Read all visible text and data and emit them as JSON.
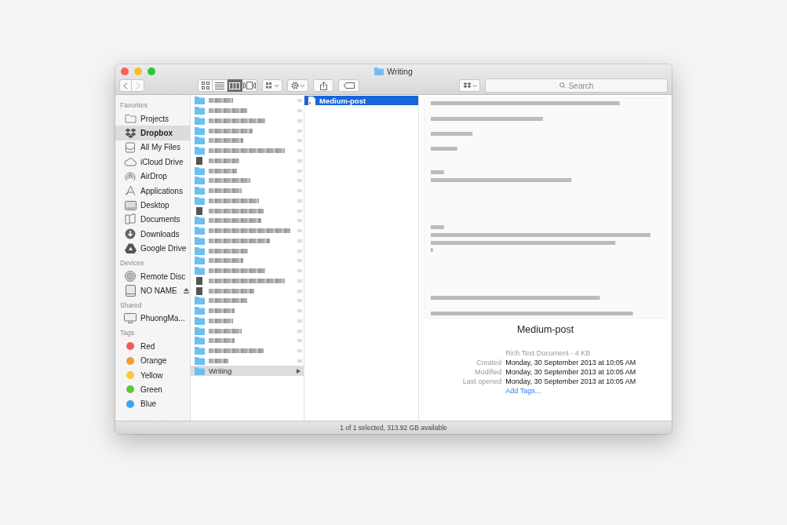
{
  "window": {
    "title": "Writing"
  },
  "toolbar": {
    "view_buttons": [
      {
        "kind": "icon",
        "selected": false
      },
      {
        "kind": "list",
        "selected": false
      },
      {
        "kind": "columns",
        "selected": true
      },
      {
        "kind": "coverflow",
        "selected": false
      }
    ],
    "search": {
      "placeholder": "Search"
    }
  },
  "sidebar": {
    "sections": [
      {
        "title": "Favorites",
        "items": [
          {
            "kind": "folder",
            "label": "Projects",
            "selected": false
          },
          {
            "kind": "dropbox",
            "label": "Dropbox",
            "selected": true
          },
          {
            "kind": "allfiles",
            "label": "All My Files",
            "selected": false
          },
          {
            "kind": "cloud",
            "label": "iCloud Drive",
            "selected": false
          },
          {
            "kind": "airdrop",
            "label": "AirDrop",
            "selected": false
          },
          {
            "kind": "apps",
            "label": "Applications",
            "selected": false
          },
          {
            "kind": "desktop",
            "label": "Desktop",
            "selected": false
          },
          {
            "kind": "documents",
            "label": "Documents",
            "selected": false
          },
          {
            "kind": "downloads",
            "label": "Downloads",
            "selected": false
          },
          {
            "kind": "gdrive",
            "label": "Google Drive",
            "selected": false
          }
        ]
      },
      {
        "title": "Devices",
        "items": [
          {
            "kind": "disc",
            "label": "Remote Disc",
            "selected": false
          },
          {
            "kind": "drive",
            "label": "NO NAME",
            "selected": false,
            "eject": true
          }
        ]
      },
      {
        "title": "Shared",
        "items": [
          {
            "kind": "computer",
            "label": "PhuongMa...",
            "selected": false
          }
        ]
      },
      {
        "title": "Tags",
        "items": [
          {
            "kind": "tag",
            "label": "Red",
            "color": "#f25a53",
            "selected": false
          },
          {
            "kind": "tag",
            "label": "Orange",
            "color": "#f79a35",
            "selected": false
          },
          {
            "kind": "tag",
            "label": "Yellow",
            "color": "#f6c938",
            "selected": false
          },
          {
            "kind": "tag",
            "label": "Green",
            "color": "#5bc63f",
            "selected": false
          },
          {
            "kind": "tag",
            "label": "Blue",
            "color": "#3ba6f4",
            "selected": false
          }
        ]
      }
    ]
  },
  "columns": [
    {
      "items": [
        {
          "kind": "folder"
        },
        {
          "kind": "folder"
        },
        {
          "kind": "folder"
        },
        {
          "kind": "folder"
        },
        {
          "kind": "folder"
        },
        {
          "kind": "folder"
        },
        {
          "kind": "file"
        },
        {
          "kind": "folder"
        },
        {
          "kind": "folder"
        },
        {
          "kind": "folder"
        },
        {
          "kind": "folder"
        },
        {
          "kind": "file"
        },
        {
          "kind": "folder"
        },
        {
          "kind": "folder"
        },
        {
          "kind": "folder"
        },
        {
          "kind": "folder"
        },
        {
          "kind": "folder"
        },
        {
          "kind": "folder"
        },
        {
          "kind": "file"
        },
        {
          "kind": "file"
        },
        {
          "kind": "folder"
        },
        {
          "kind": "folder"
        },
        {
          "kind": "folder"
        },
        {
          "kind": "folder"
        },
        {
          "kind": "folder"
        },
        {
          "kind": "folder"
        },
        {
          "kind": "folder"
        },
        {
          "kind": "folder",
          "name": "Writing",
          "selected": true
        }
      ]
    },
    {
      "items": [
        {
          "kind": "document",
          "name": "Medium-post",
          "selected": true
        }
      ]
    }
  ],
  "preview": {
    "name": "Medium-post",
    "kind_size": "Rich Text Document - 4 KB",
    "info": [
      {
        "label": "Created",
        "value": "Monday, 30 September 2013 at 10:05 AM"
      },
      {
        "label": "Modified",
        "value": "Monday, 30 September 2013 at 10:05 AM"
      },
      {
        "label": "Last opened",
        "value": "Monday, 30 September 2013 at 10:05 AM"
      }
    ],
    "add_tags": "Add Tags..."
  },
  "status_bar": "1 of 1 selected, 313.92 GB available"
}
